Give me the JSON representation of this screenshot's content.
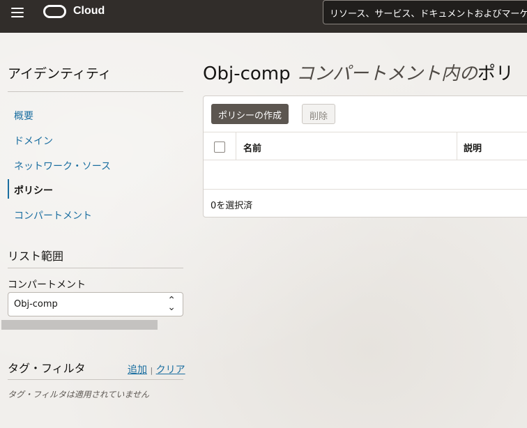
{
  "header": {
    "app_name": "Cloud",
    "search_placeholder": "リソース、サービス、ドキュメントおよびマーケ"
  },
  "sidebar": {
    "title": "アイデンティティ",
    "items": [
      {
        "label": "概要",
        "active": false
      },
      {
        "label": "ドメイン",
        "active": false
      },
      {
        "label": "ネットワーク・ソース",
        "active": false
      },
      {
        "label": "ポリシー",
        "active": true
      },
      {
        "label": "コンパートメント",
        "active": false
      }
    ],
    "list_scope": {
      "heading": "リスト範囲",
      "compartment_label": "コンパートメント",
      "compartment_value": "Obj-comp"
    },
    "tag_filters": {
      "heading": "タグ・フィルタ",
      "add_label": "追加",
      "separator": "|",
      "clear_label": "クリア",
      "empty_text": "タグ・フィルタは適用されていません"
    }
  },
  "main": {
    "title_name": "Obj-comp",
    "title_suffix": "コンパートメント内の",
    "title_tail": "ポリ",
    "create_button": "ポリシーの作成",
    "delete_button": "削除",
    "columns": [
      "名前",
      "説明"
    ],
    "selection_status": "0を選択済"
  },
  "colors": {
    "topbar": "#312d2a",
    "link": "#1a6ea0",
    "primary_button": "#5c5650"
  }
}
